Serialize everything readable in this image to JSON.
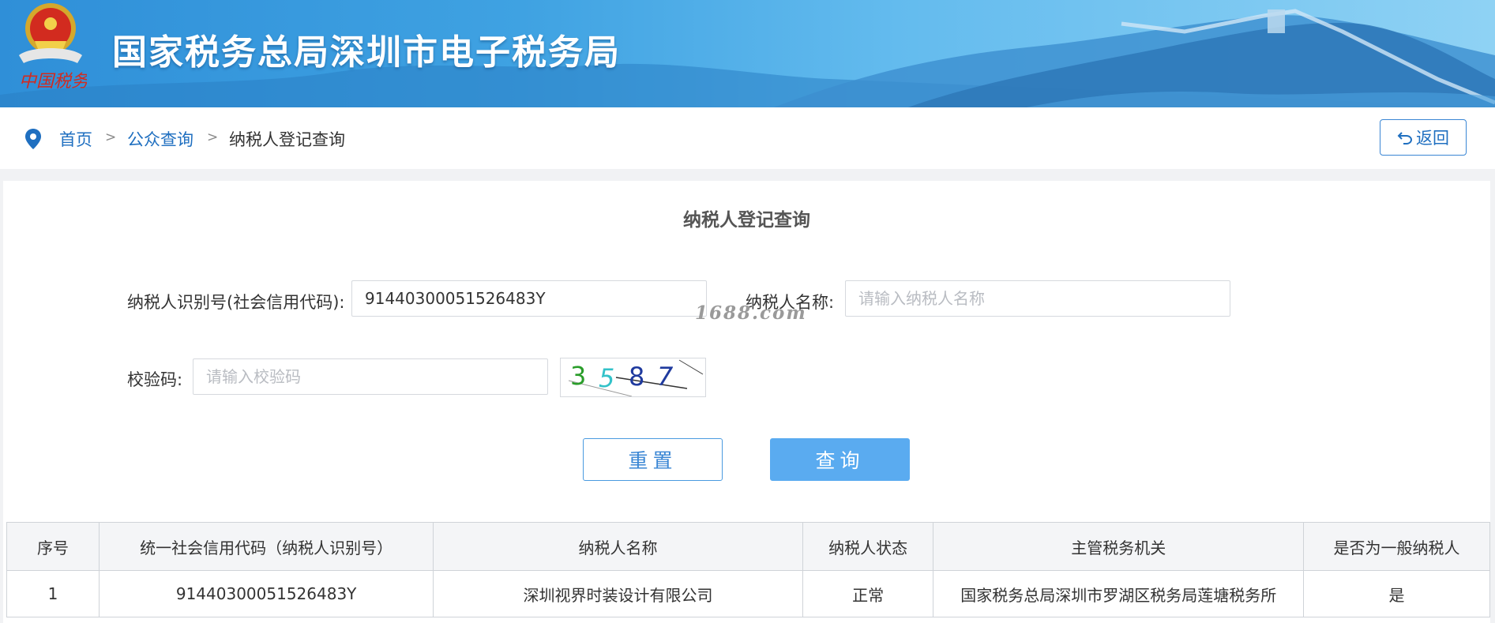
{
  "header": {
    "site_title": "国家税务总局深圳市电子税务局",
    "emblem_caption": "中国税务",
    "colors": {
      "banner_dark": "#2f8fd8",
      "banner_light": "#8fd2f4"
    }
  },
  "breadcrumb": {
    "items": [
      {
        "label": "首页"
      },
      {
        "label": "公众查询"
      },
      {
        "label": "纳税人登记查询"
      }
    ],
    "separator": ">",
    "back_label": "返回"
  },
  "form": {
    "title": "纳税人登记查询",
    "taxpayer_id_label": "纳税人识别号(社会信用代码):",
    "taxpayer_id_value": "91440300051526483Y",
    "taxpayer_name_label": "纳税人名称:",
    "taxpayer_name_placeholder": "请输入纳税人名称",
    "captcha_label": "校验码:",
    "captcha_placeholder": "请输入校验码",
    "captcha_image_text": "3587",
    "watermark": "1688.com",
    "reset_label": "重置",
    "query_label": "查询"
  },
  "results": {
    "columns": [
      "序号",
      "统一社会信用代码（纳税人识别号）",
      "纳税人名称",
      "纳税人状态",
      "主管税务机关",
      "是否为一般纳税人"
    ],
    "rows": [
      [
        "1",
        "91440300051526483Y",
        "深圳视界时装设计有限公司",
        "正常",
        "国家税务总局深圳市罗湖区税务局莲塘税务所",
        "是"
      ]
    ]
  }
}
